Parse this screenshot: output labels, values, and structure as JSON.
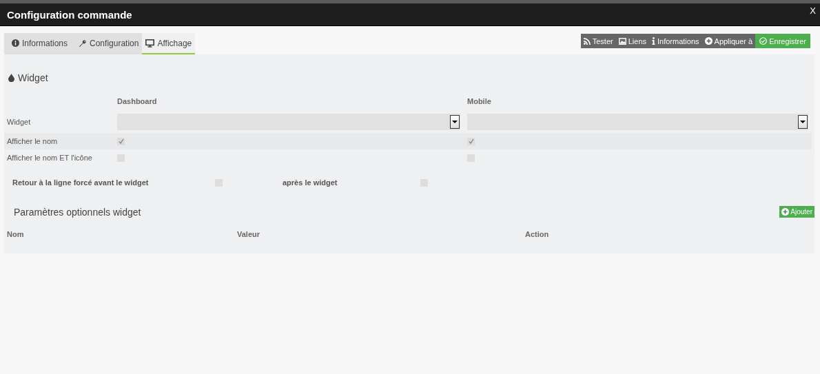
{
  "window": {
    "title": "Configuration commande",
    "close": "X"
  },
  "tabs": [
    {
      "label": "Informations",
      "selected": false
    },
    {
      "label": "Configuration",
      "selected": false
    },
    {
      "label": "Affichage",
      "selected": true
    }
  ],
  "toolbar": [
    {
      "label": "Tester",
      "kind": "plain"
    },
    {
      "label": "Liens",
      "kind": "plain"
    },
    {
      "label": "Informations",
      "kind": "plain"
    },
    {
      "label": "Appliquer à",
      "kind": "plain"
    },
    {
      "label": "Enregistrer",
      "kind": "primary"
    }
  ],
  "section": {
    "title": "Widget"
  },
  "columns": [
    "Dashboard",
    "Mobile"
  ],
  "rows": [
    {
      "label": "Widget",
      "kind": "select"
    },
    {
      "label": "Afficher le nom",
      "kind": "checkbox",
      "dashboard_checked": true,
      "mobile_checked": true
    },
    {
      "label": "Afficher le nom ET l'icône",
      "kind": "checkbox",
      "dashboard_checked": false,
      "mobile_checked": false
    }
  ],
  "line_break": [
    {
      "label": "Retour à la ligne forcé avant le widget",
      "checked": false
    },
    {
      "label": "après le widget",
      "checked": false
    }
  ],
  "optional_params": {
    "title": "Paramètres optionnels widget",
    "add_button": "Ajouter",
    "columns": [
      "Nom",
      "Valeur",
      "Action"
    ]
  }
}
